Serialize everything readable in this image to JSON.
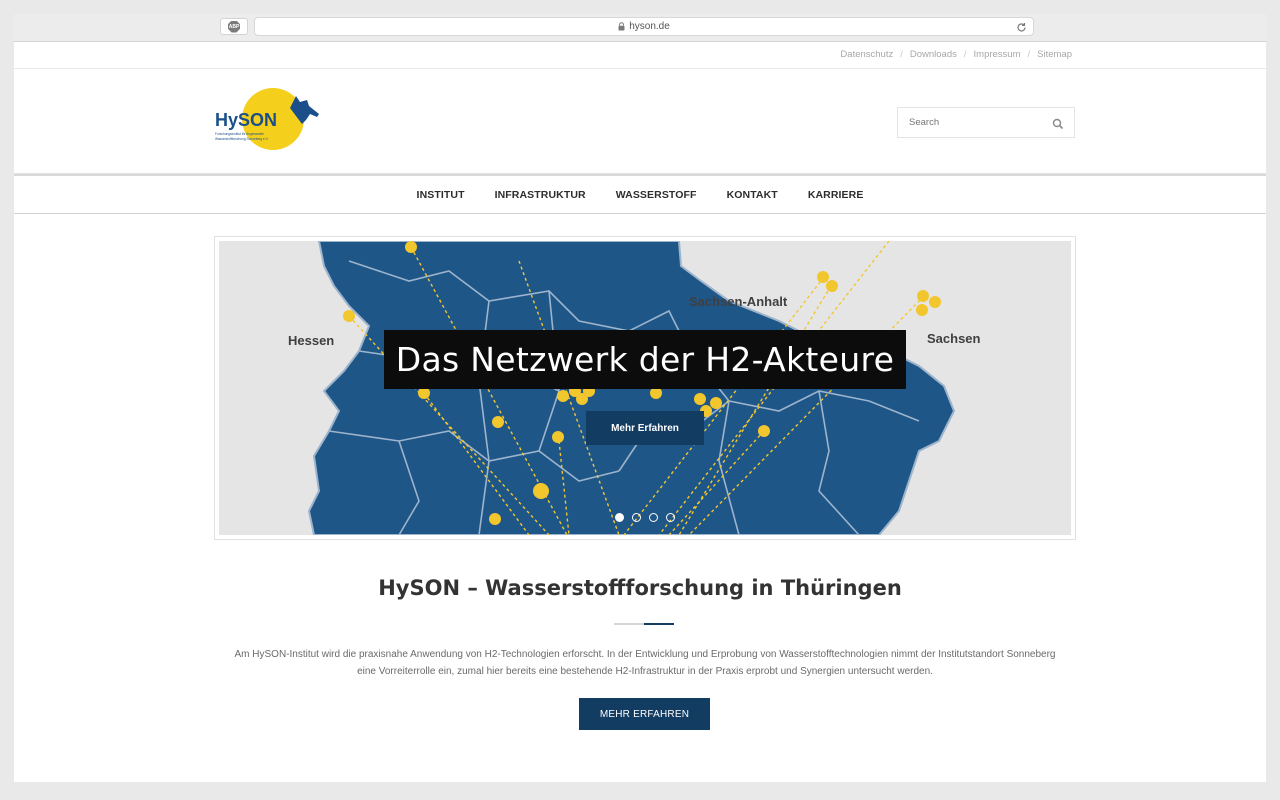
{
  "browser": {
    "url": "hyson.de",
    "adblock_label": "ABP"
  },
  "toplinks": [
    "Datenschutz",
    "Downloads",
    "Impressum",
    "Sitemap"
  ],
  "logo": {
    "wordmark_hy": "Hy",
    "wordmark_son": "SON",
    "tagline_line1": "Forschungsinstitut für Angewandte",
    "tagline_line2": "Wasserstoffforschung Sonneberg e.V.",
    "colors": {
      "blue": "#1b4f8a",
      "yellow": "#f4cf1b"
    }
  },
  "search": {
    "placeholder": "Search"
  },
  "nav": [
    "INSTITUT",
    "INFRASTRUKTUR",
    "WASSERSTOFF",
    "KONTAKT",
    "KARRIERE"
  ],
  "slider": {
    "title": "Das Netzwerk der H2-Akteure",
    "button": "Mehr Erfahren",
    "regions": [
      "Hessen",
      "Sachsen-Anhalt",
      "Sachsen"
    ],
    "slides_total": 4,
    "active_slide": 1,
    "colors": {
      "map": "#1f5688",
      "dots": "#f2c62d",
      "border": "#9cb4cc",
      "background": "#e5e5e5"
    }
  },
  "intro": {
    "title": "HySON – Wasserstoffforschung in Thüringen",
    "text_line1": "Am HySON-Institut wird die praxisnahe Anwendung von H2-Technologien erforscht. In der Entwicklung und Erprobung von Wasserstofftechnologien nimmt der Institutstandort Sonneberg",
    "text_line2": "eine Vorreiterrolle ein, zumal hier bereits eine bestehende H2-Infrastruktur in der Praxis erprobt und Synergien untersucht werden.",
    "button": "MEHR ERFAHREN"
  }
}
